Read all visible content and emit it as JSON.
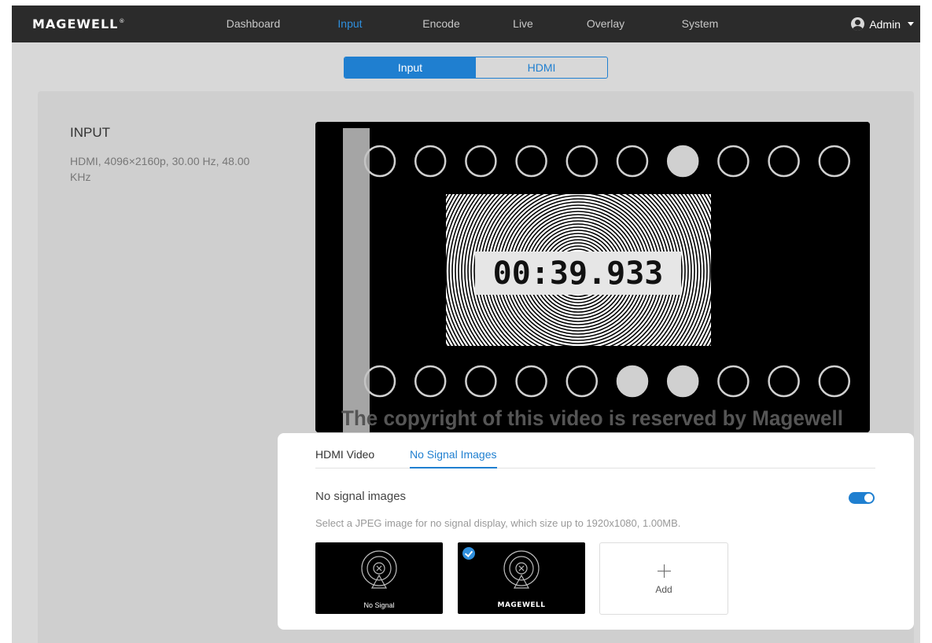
{
  "brand": {
    "logo": "MAGEWELL",
    "reg": "®"
  },
  "nav": [
    {
      "label": "Dashboard",
      "active": false
    },
    {
      "label": "Input",
      "active": true
    },
    {
      "label": "Encode",
      "active": false
    },
    {
      "label": "Live",
      "active": false
    },
    {
      "label": "Overlay",
      "active": false
    },
    {
      "label": "System",
      "active": false
    }
  ],
  "user": {
    "name": "Admin"
  },
  "subtabs": [
    {
      "label": "Input",
      "active": true
    },
    {
      "label": "HDMI",
      "active": false
    }
  ],
  "input": {
    "title": "INPUT",
    "signal": "HDMI, 4096×2160p, 30.00 Hz, 48.00 KHz"
  },
  "preview": {
    "timecode": "00:39.933",
    "watermark": "The copyright of this video is reserved by Magewell",
    "top_row_filled": [
      false,
      false,
      false,
      false,
      false,
      false,
      true,
      false,
      false,
      false
    ],
    "bottom_row_filled": [
      false,
      false,
      false,
      false,
      false,
      true,
      true,
      false,
      false,
      false
    ]
  },
  "panel": {
    "tabs": [
      {
        "label": "HDMI Video",
        "active": false
      },
      {
        "label": "No Signal Images",
        "active": true
      }
    ],
    "no_signal_label": "No signal images",
    "toggle_on": true,
    "hint": "Select a JPEG image for no signal display, which size up to 1920x1080, 1.00MB.",
    "images": [
      {
        "caption": "No Signal",
        "selected": false
      },
      {
        "caption": "MAGEWELL",
        "selected": true
      }
    ],
    "add_label": "Add"
  },
  "colors": {
    "accent": "#1f7fd0",
    "nav_bg": "#2b2b2b"
  }
}
